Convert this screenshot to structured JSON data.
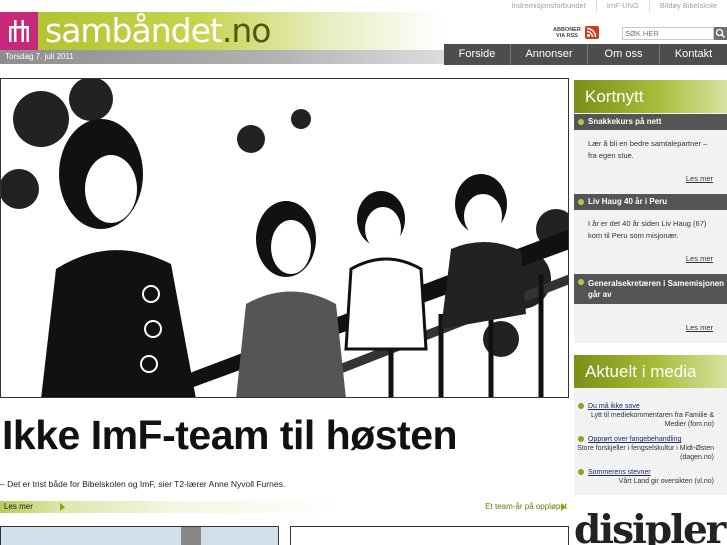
{
  "colors": {
    "brand_magenta": "#c7287a",
    "brand_green": "#a9bd3b",
    "nav_bg": "#4d4d4d",
    "panel_title_bg": "#555555"
  },
  "header": {
    "logo_name": "sambåndet",
    "logo_tld": ".no",
    "date": "Torsdag 7. juli 2011",
    "top_links": [
      "Indremisjonsforbundet",
      "ImF-UNG",
      "Bildøy Bibelskole"
    ],
    "rss_label_1": "ABBONER",
    "rss_label_2": "VIA RSS",
    "search": {
      "placeholder": "SØK HER"
    }
  },
  "nav": {
    "items": [
      {
        "label": "Forside"
      },
      {
        "label": "Annonser"
      },
      {
        "label": "Om oss"
      },
      {
        "label": "Kontakt"
      }
    ]
  },
  "article": {
    "headline": "Ikke ImF-team til høsten",
    "lede": "– Det er trist både for Bibelskolen og ImF, sier T2-lærer Anne Nyvoll Furnes.",
    "more_label": "Les mer",
    "side_link": "Et team-år på oppløpet"
  },
  "kortnytt": {
    "title": "Kortnytt",
    "items": [
      {
        "title": "Snakkekurs på nett",
        "body": "Lær å bli en bedre samtalepartner – fra egen stue.",
        "more": "Les mer"
      },
      {
        "title": "Liv Haug 40 år i Peru",
        "body": "I år er det 40 år siden Liv Haug (67) kom til Peru som misjonær.",
        "more": "Les mer"
      },
      {
        "title": "Generalsekretæren i Samemisjonen går av",
        "body": "",
        "more": "Les mer"
      }
    ]
  },
  "media": {
    "title": "Aktuelt i media",
    "items": [
      {
        "link": "Du må ikke sove",
        "desc": "Lytt til mediekommentaren fra Familie & Medier (fom.no)"
      },
      {
        "link": "Opprørt over fangebehandling",
        "desc": "Store forskjeller i fengselskultur i Midt-Østen (dagen.no)"
      },
      {
        "link": "Sommerens stevner",
        "desc": "Vårt Land gir oversikten (vl.no)"
      }
    ]
  },
  "ad": {
    "text": "disipler"
  }
}
